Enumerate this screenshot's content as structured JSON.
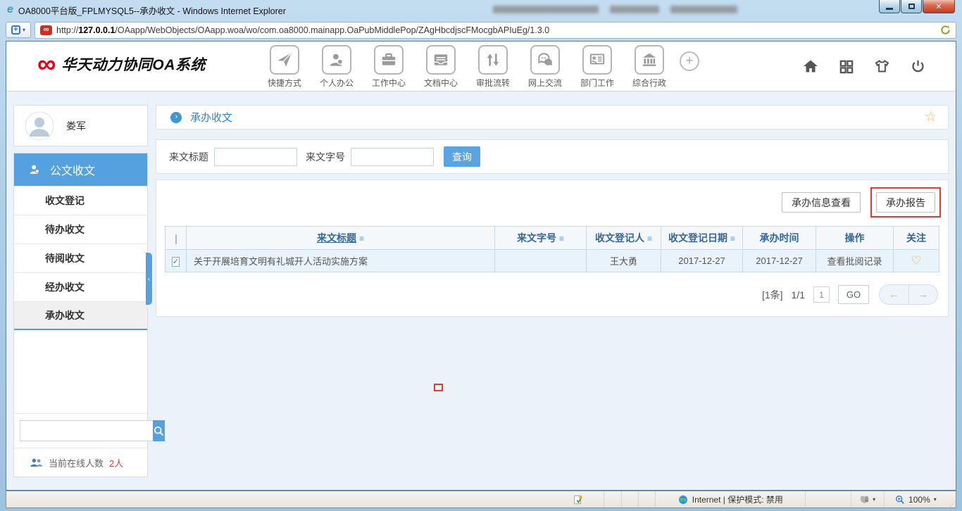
{
  "window": {
    "title": "OA8000平台版_FPLMYSQL5--承办收文 - Windows Internet Explorer",
    "url_scheme": "http://",
    "url_host": "127.0.0.1",
    "url_path": "/OAapp/WebObjects/OAapp.woa/wo/com.oa8000.mainapp.OaPubMiddlePop/ZAgHbcdjscFMocgbAPIuEg/1.3.0"
  },
  "header": {
    "logo_text": "华天动力协同OA系统",
    "nav": [
      "快捷方式",
      "个人办公",
      "工作中心",
      "文档中心",
      "审批流转",
      "网上交流",
      "部门工作",
      "综合行政"
    ]
  },
  "sidebar": {
    "user_name": "娄军",
    "section_label": "公文收文",
    "items": [
      "收文登记",
      "待办收文",
      "待阅收文",
      "经办收文",
      "承办收文"
    ],
    "selected_item": "承办收文",
    "online_label": "当前在线人数",
    "online_count": "2人"
  },
  "main": {
    "breadcrumb": "承办收文",
    "filters": {
      "title_label": "来文标题",
      "number_label": "来文字号",
      "search_label": "查询"
    },
    "actions": [
      "承办信息查看",
      "承办报告"
    ],
    "table": {
      "headers": [
        "来文标题",
        "来文字号",
        "收文登记人",
        "收文登记日期",
        "承办时间",
        "操作",
        "关注"
      ],
      "rows": [
        {
          "checked": true,
          "title": "关于开展培育文明有礼城开人活动实施方案",
          "number": "",
          "registrant": "王大勇",
          "reg_date": "2017-12-27",
          "handle_date": "2017-12-27",
          "operation": "查看批阅记录"
        }
      ]
    },
    "pagination": {
      "total": "[1条]",
      "page_indicator": "1/1",
      "page_value": "1",
      "go_label": "GO"
    }
  },
  "statusbar": {
    "zone_text": "Internet | 保护模式: 禁用",
    "zoom_level": "100%"
  },
  "colors": {
    "accent_blue": "#55a1e0",
    "link_blue": "#2e86c8",
    "table_header_text": "#33679e",
    "row_bg": "#e9f3fb",
    "annotation_red": "#e23b30",
    "star_orange": "#f5b83d",
    "heart_orange": "#f5a623",
    "online_red": "#e03c3c",
    "logo_red": "#e60012"
  },
  "icons": {
    "ie": "e",
    "infinity": "∞",
    "plus": "+",
    "sort": "≡",
    "heart": "♡",
    "star": "☆",
    "check": "✓",
    "arrow_left": "←",
    "arrow_right": "→",
    "crumb_chevron": "›",
    "collapse_chevron": "‹",
    "close": "✕",
    "dropdown": "▾"
  }
}
